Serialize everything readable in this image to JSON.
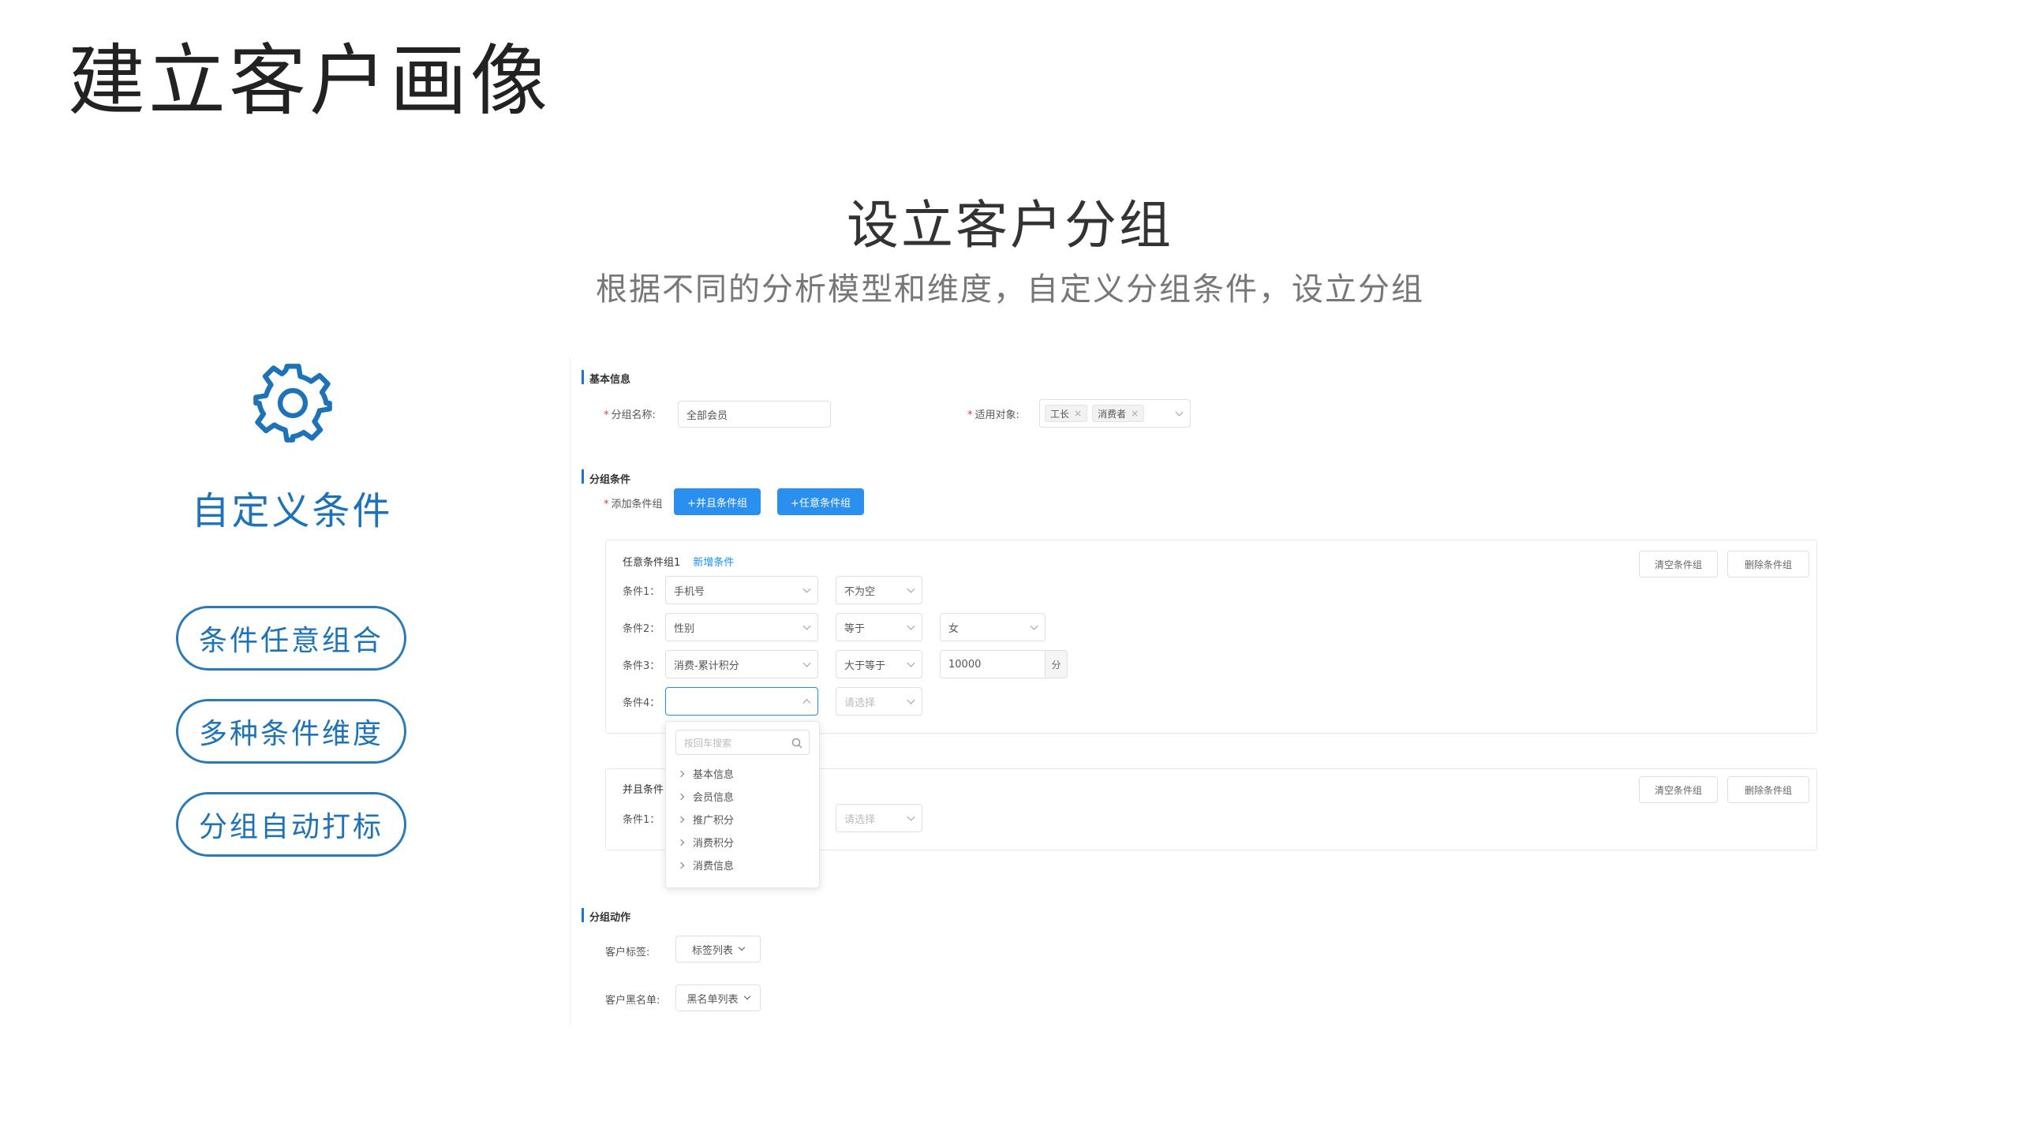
{
  "page": {
    "title": "建立客户画像"
  },
  "section": {
    "title": "设立客户分组",
    "subtitle": "根据不同的分析模型和维度，自定义分组条件，设立分组"
  },
  "feature": {
    "icon": "gear-icon",
    "title": "自定义条件",
    "pills": [
      "条件任意组合",
      "多种条件维度",
      "分组自动打标"
    ]
  },
  "colors": {
    "accent": "#1e73b8",
    "primary_button": "#2b8ff0",
    "required": "#e53935"
  },
  "form": {
    "basic": {
      "heading": "基本信息",
      "name_label": "分组名称:",
      "name_value": "全部会员",
      "target_label": "适用对象:",
      "target_tags": [
        "工长",
        "消费者"
      ]
    },
    "conditions": {
      "heading": "分组条件",
      "add_label": "添加条件组",
      "and_button": "+并且条件组",
      "any_button": "+任意条件组",
      "group1": {
        "title": "任意条件组1",
        "add_link": "新增条件",
        "clear_button": "清空条件组",
        "delete_button": "删除条件组",
        "rows": [
          {
            "label": "条件1：",
            "field": "手机号",
            "op": "不为空",
            "value": ""
          },
          {
            "label": "条件2：",
            "field": "性别",
            "op": "等于",
            "value": "女"
          },
          {
            "label": "条件3：",
            "field": "消费-累计积分",
            "op": "大于等于",
            "value": "10000",
            "unit": "分"
          },
          {
            "label": "条件4：",
            "field": "",
            "op_placeholder": "请选择",
            "value": ""
          }
        ]
      },
      "group2": {
        "title": "并且条件",
        "clear_button": "清空条件组",
        "delete_button": "删除条件组",
        "rows": [
          {
            "label": "条件1：",
            "op_placeholder": "请选择"
          }
        ]
      },
      "dropdown": {
        "search_placeholder": "按回车搜索",
        "items": [
          "基本信息",
          "会员信息",
          "推广积分",
          "消费积分",
          "消费信息"
        ]
      }
    },
    "actions": {
      "heading": "分组动作",
      "tag_label": "客户标签:",
      "tag_select": "标签列表",
      "blacklist_label": "客户黑名单:",
      "blacklist_select": "黑名单列表"
    }
  }
}
